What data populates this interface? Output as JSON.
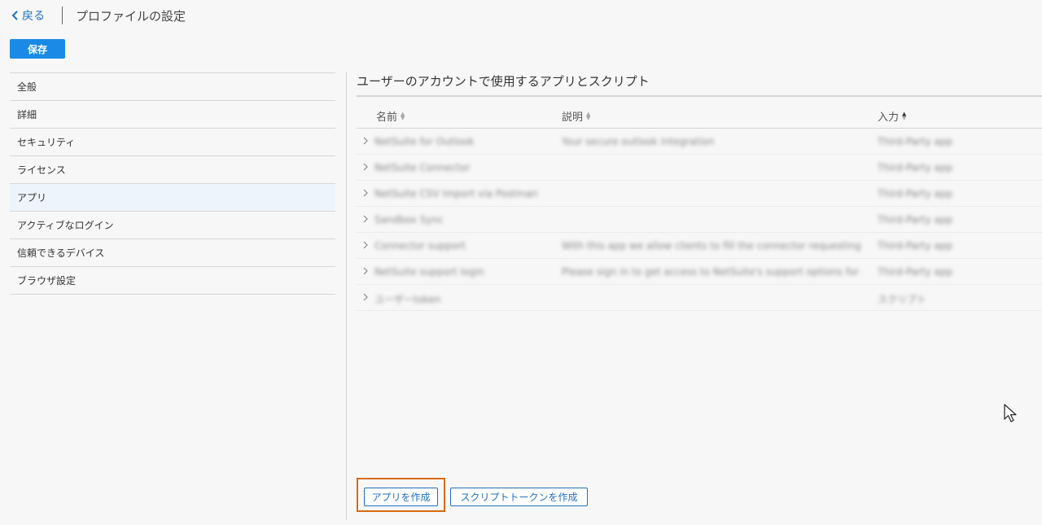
{
  "header": {
    "back_label": "戻る",
    "title": "プロファイルの設定"
  },
  "toolbar": {
    "save_label": "保存"
  },
  "sidebar": {
    "items": [
      {
        "label": "全般"
      },
      {
        "label": "詳細"
      },
      {
        "label": "セキュリティ"
      },
      {
        "label": "ライセンス"
      },
      {
        "label": "アプリ",
        "active": true
      },
      {
        "label": "アクティブなログイン"
      },
      {
        "label": "信頼できるデバイス"
      },
      {
        "label": "ブラウザ設定"
      }
    ]
  },
  "main": {
    "section_title": "ユーザーのアカウントで使用するアプリとスクリプト",
    "columns": {
      "name": "名前",
      "description": "説明",
      "input": "入力"
    },
    "rows": [
      {
        "name": "NetSuite for Outlook",
        "description": "Your secure outlook integration",
        "input": "Third-Party app"
      },
      {
        "name": "NetSuite Connector",
        "description": "",
        "input": "Third-Party app"
      },
      {
        "name": "NetSuite CSV Import via Postman",
        "description": "",
        "input": "Third-Party app"
      },
      {
        "name": "Sandbox Sync",
        "description": "",
        "input": "Third-Party app"
      },
      {
        "name": "Connector support",
        "description": "With this app we allow clients to fill the connector requesting form",
        "input": "Third-Party app"
      },
      {
        "name": "NetSuite support login",
        "description": "Please sign in to get access to NetSuite's support options for customers",
        "input": "Third-Party app"
      },
      {
        "name": "ユーザーtoken",
        "description": "",
        "input": "スクリプト"
      }
    ]
  },
  "actions": {
    "create_app_label": "アプリを作成",
    "create_token_label": "スクリプトトークンを作成"
  },
  "colors": {
    "accent": "#1a8ae6",
    "link": "#1e6fc0",
    "highlight": "#d96a10"
  }
}
